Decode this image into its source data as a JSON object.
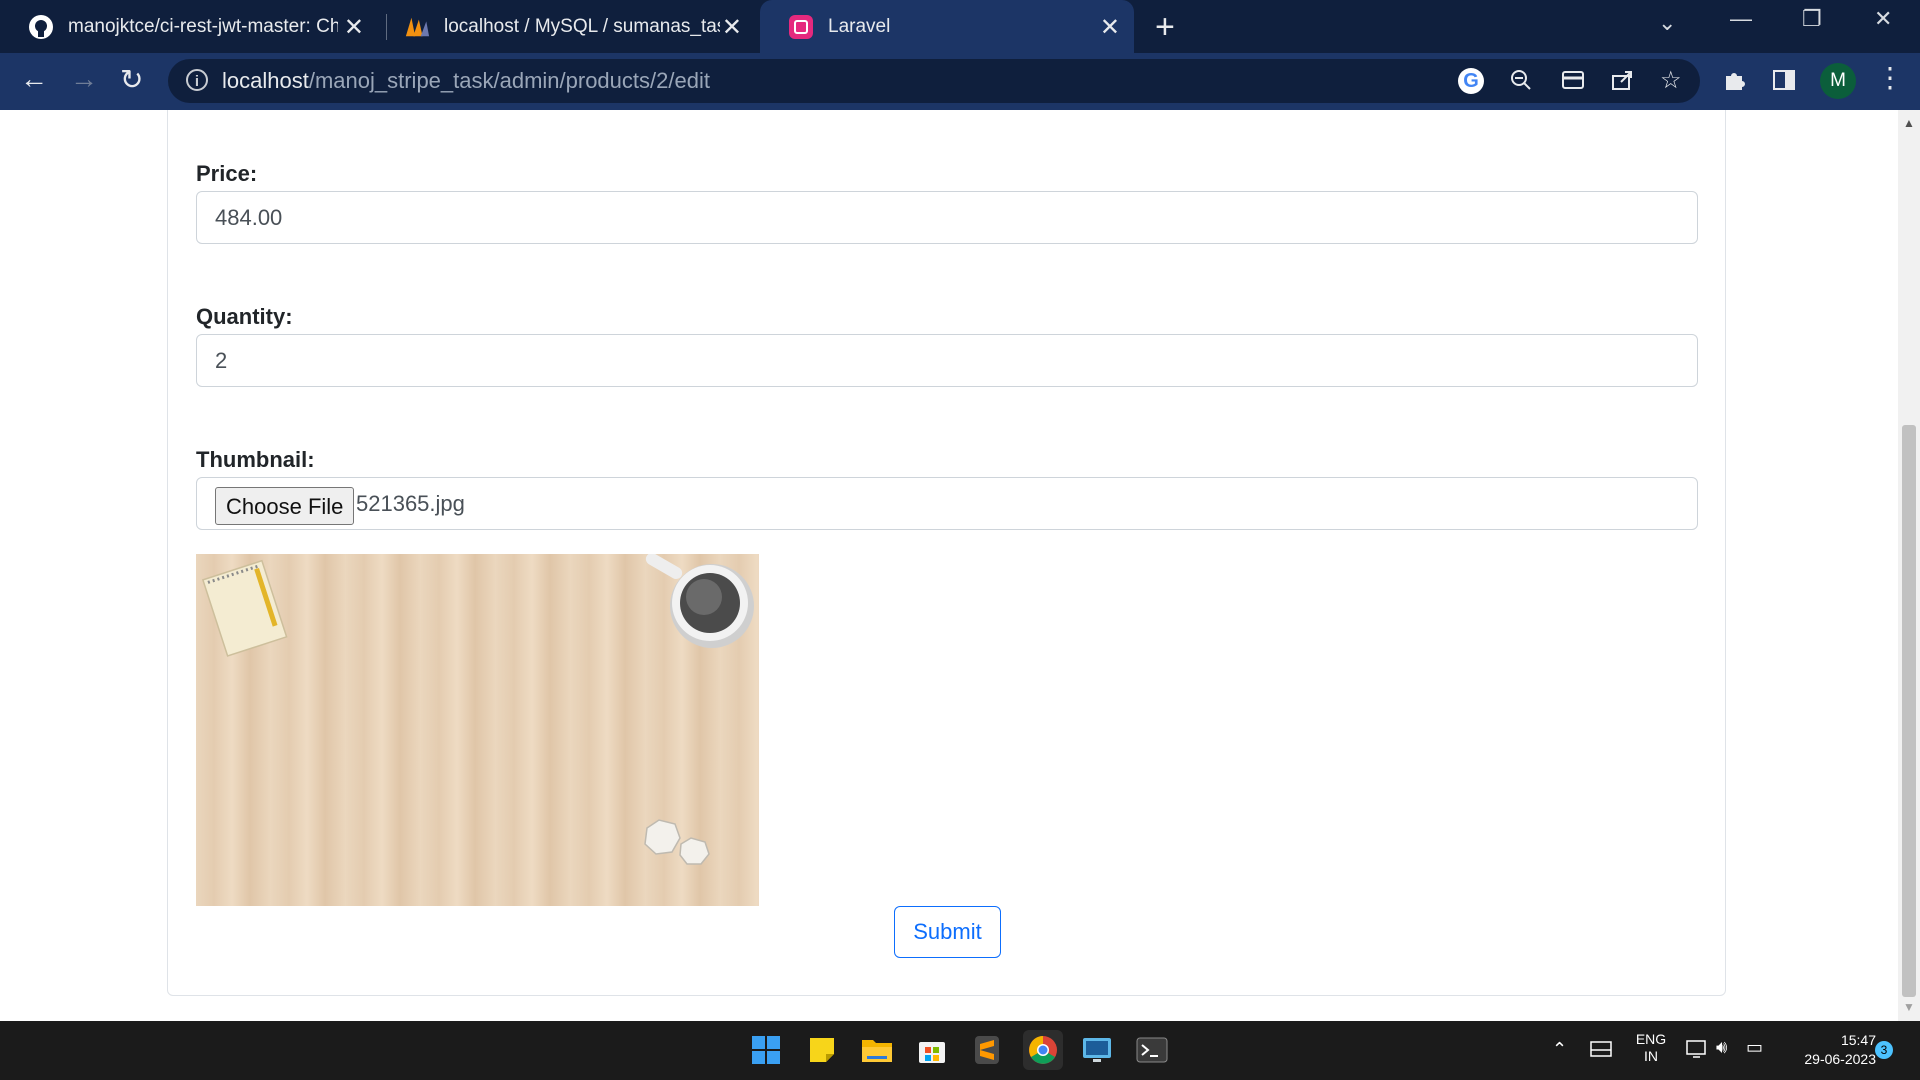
{
  "browser": {
    "tabs": [
      {
        "title": "manojktce/ci-rest-jwt-master: Ch",
        "favicon": "github-icon",
        "active": false
      },
      {
        "title": "localhost / MySQL / sumanas_tas",
        "favicon": "phpmyadmin-icon",
        "active": false
      },
      {
        "title": "Laravel",
        "favicon": "laravel-icon",
        "active": true
      }
    ],
    "new_tab": "+",
    "address": {
      "host": "localhost",
      "path": "/manoj_stripe_task/admin/products/2/edit"
    },
    "profile_initial": "M"
  },
  "form": {
    "price_label": "Price:",
    "price_value": "484.00",
    "quantity_label": "Quantity:",
    "quantity_value": "2",
    "thumbnail_label": "Thumbnail:",
    "choose_file_label": "Choose File",
    "file_name": "521365.jpg",
    "submit_label": "Submit"
  },
  "taskbar": {
    "language_line1": "ENG",
    "language_line2": "IN",
    "time": "15:47",
    "date": "29-06-2023",
    "notification_count": "3"
  },
  "colors": {
    "tab_strip": "#0f1f3d",
    "toolbar": "#1c3566",
    "accent": "#0d6efd"
  }
}
